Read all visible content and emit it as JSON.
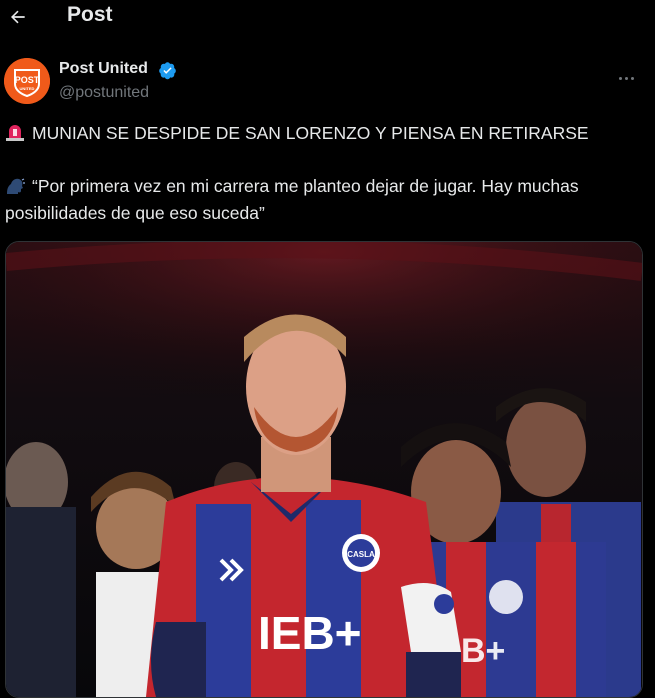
{
  "header": {
    "title": "Post",
    "back_icon": "arrow-left-icon"
  },
  "author": {
    "name": "Post United",
    "handle": "@postunited",
    "verified": true,
    "avatar_text_top": "POST",
    "avatar_text_bottom": "UNITED",
    "brand_color": "#f05a1a"
  },
  "tweet": {
    "headline_emoji": "rotating-light-icon",
    "headline": "MUNIAN SE DESPIDE DE SAN LORENZO Y PIENSA EN RETIRARSE",
    "quote_emoji": "speaking-head-icon",
    "quote_line1": "“Por primera vez en mi carrera me planteo dejar de jugar. Hay muchas",
    "quote_line2": "posibilidades de que eso suceda”"
  },
  "media": {
    "shirt_text": "IEB+",
    "crest_text": "CASLA"
  },
  "colors": {
    "background": "#000000",
    "text": "#e7e9ea",
    "secondary": "#71767b",
    "verified": "#1d9bf0"
  }
}
